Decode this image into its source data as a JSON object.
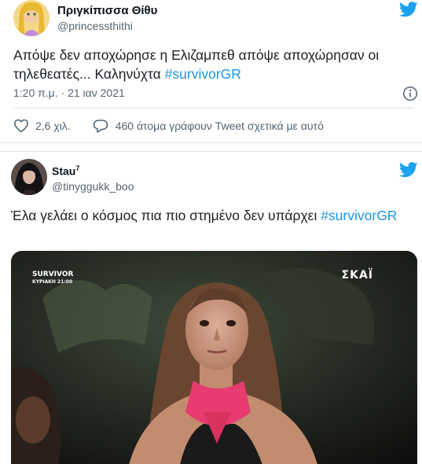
{
  "tweets": [
    {
      "display_name": "Πριγκίπισσα Θίθυ",
      "handle": "@princessthithi",
      "text": "Απόψε δεν αποχώρησε η Ελιζαμπεθ απόψε αποχώρησαν οι τηλεθεατές... Καληνύχτα ",
      "hashtag": "#survivorGR",
      "timestamp": "1:20 π.μ. · 21 ιαν 2021",
      "likes": "2,6 χιλ.",
      "replies_text": "460 άτομα γράφουν Tweet σχετικά με αυτό",
      "icons": [
        "twitter-bird-icon",
        "info-icon",
        "heart-icon",
        "speech-bubble-icon"
      ]
    },
    {
      "display_name": "Stau",
      "display_name_sup": "7",
      "handle": "@tinyggukk_boo",
      "text": "Έλα γελάει ο κόσμος πια πιο στημένο δεν υπάρχει ",
      "hashtag": "#survivorGR",
      "media": {
        "badge_line1": "SURVIVOR",
        "badge_line2": "ΚΥΡΙΑΚΗ 21:00",
        "channel_logo": "ΣΚΑΪ"
      }
    }
  ],
  "colors": {
    "accent": "#1b95e0",
    "twitter_blue": "#1da1f2",
    "secondary_text": "#536471",
    "border": "#e1e8ed"
  }
}
